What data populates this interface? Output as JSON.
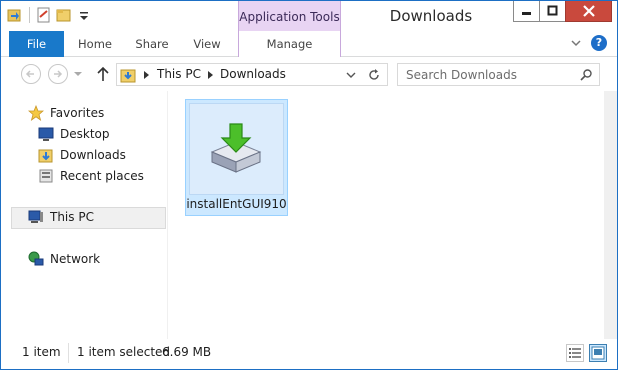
{
  "window": {
    "title": "Downloads"
  },
  "context_tab": {
    "header": "Application Tools",
    "tab": "Manage"
  },
  "tabs": {
    "file": "File",
    "home": "Home",
    "share": "Share",
    "view": "View"
  },
  "address": {
    "crumbs": [
      "This PC",
      "Downloads"
    ]
  },
  "search": {
    "placeholder": "Search Downloads"
  },
  "nav": {
    "favorites": "Favorites",
    "desktop": "Desktop",
    "downloads": "Downloads",
    "recent": "Recent places",
    "this_pc": "This PC",
    "network": "Network"
  },
  "files": [
    {
      "name": "installEntGUI910"
    }
  ],
  "status": {
    "count": "1 item",
    "selection": "1 item selected",
    "size": "6.69 MB"
  },
  "colors": {
    "accent": "#1979ca",
    "context": "#e8d4f3",
    "close": "#c9493d",
    "selection": "#cce8ff"
  }
}
